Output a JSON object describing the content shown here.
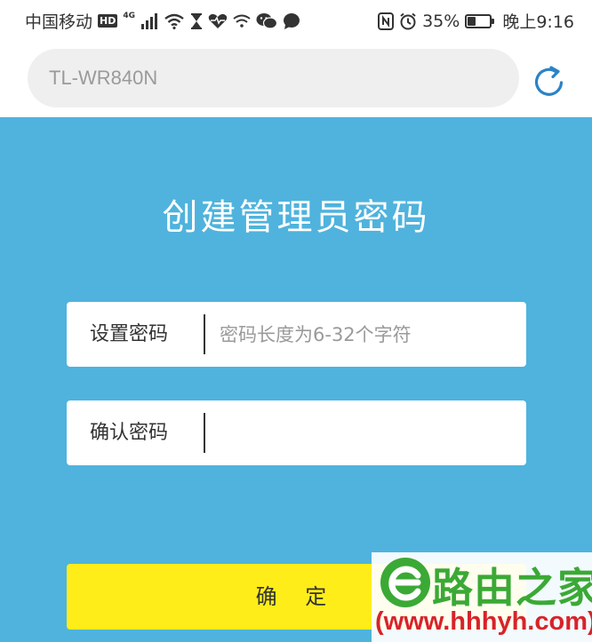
{
  "status_bar": {
    "carrier": "中国移动",
    "hd_badge": "HD",
    "network_type": "4G",
    "battery_level": "35%",
    "battery_fraction": 0.35,
    "time": "晚上9:16"
  },
  "browser": {
    "url": "TL-WR840N"
  },
  "page": {
    "title": "创建管理员密码",
    "set_password": {
      "label": "设置密码",
      "placeholder": "密码长度为6-32个字符",
      "value": ""
    },
    "confirm_password": {
      "label": "确认密码",
      "placeholder": "",
      "value": ""
    },
    "confirm_button": "确 定"
  },
  "watermark": {
    "brand": "路由之家",
    "url": "(www.hhhyh.com)"
  },
  "colors": {
    "panel_bg": "#4fb3dd",
    "button_bg": "#ffed1a",
    "watermark_green": "#3ba935",
    "watermark_red": "#d8232a"
  },
  "icons": {
    "status": [
      "hd-badge",
      "signal-icon",
      "wifi-icon",
      "hourglass-icon",
      "heart-rate-icon",
      "wifi-small-icon",
      "wechat-icon",
      "message-icon",
      "nfc-icon",
      "alarm-icon",
      "battery-icon"
    ],
    "browser": [
      "reload-icon"
    ]
  }
}
